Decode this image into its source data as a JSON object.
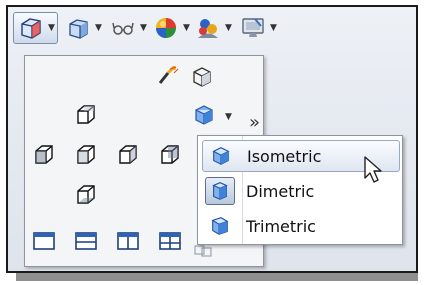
{
  "toolbar": {
    "buttons": [
      {
        "name": "view-orientation",
        "icon": "view-orientation-icon",
        "has_dropdown": true,
        "active": true
      },
      {
        "name": "display-style",
        "icon": "shaded-box-icon",
        "has_dropdown": true
      },
      {
        "name": "hide-show-items",
        "icon": "glasses-icon",
        "has_dropdown": true
      },
      {
        "name": "edit-appearance",
        "icon": "color-sphere-icon",
        "has_dropdown": true
      },
      {
        "name": "apply-scene",
        "icon": "scene-icon",
        "has_dropdown": true
      },
      {
        "name": "view-settings",
        "icon": "monitor-icon",
        "has_dropdown": true
      }
    ]
  },
  "flyout": {
    "more_label": "»",
    "views": [
      "Isometric",
      "Dimetric",
      "Trimetric"
    ],
    "selected_view": "Isometric"
  },
  "colors": {
    "accent": "#3b7fd1",
    "frame": "#1a1a1a",
    "menu_bg": "#f4f5f7"
  }
}
